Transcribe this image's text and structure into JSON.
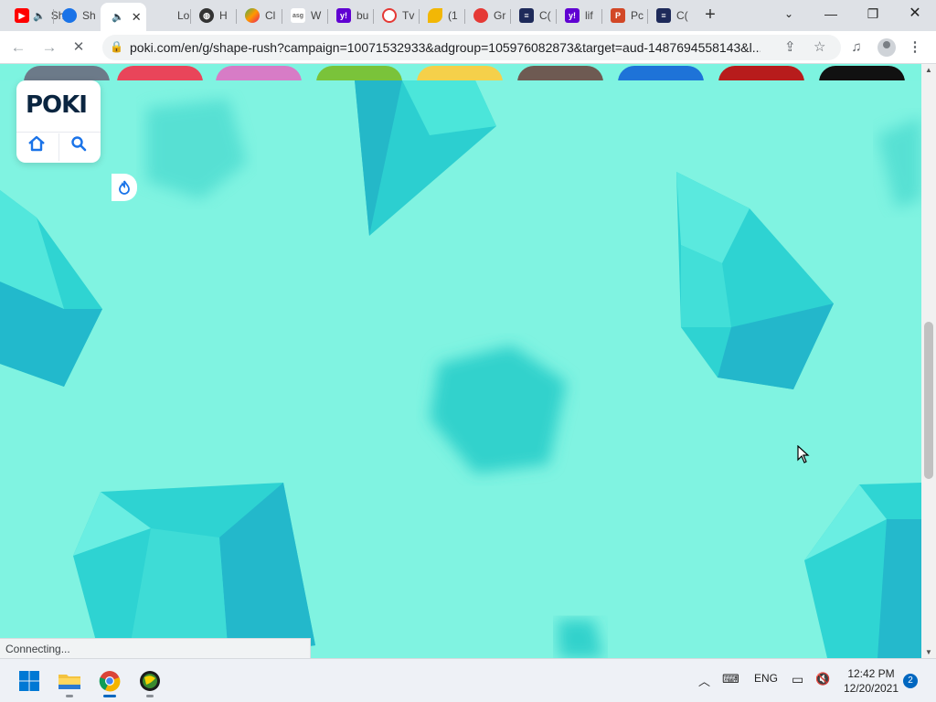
{
  "browser": {
    "tabs": [
      {
        "label": "Sh",
        "icon": "youtube-icon",
        "color": "#ff0000"
      },
      {
        "label": "Sh",
        "icon": "poki-icon",
        "color": "#1a73e8"
      },
      {
        "label": "",
        "icon": "speaker-icon",
        "color": "#333333",
        "active": true
      },
      {
        "label": "Lo",
        "icon": "blank-icon",
        "color": "#cccccc"
      },
      {
        "label": "H",
        "icon": "globe-icon",
        "color": "#333333"
      },
      {
        "label": "Cl",
        "icon": "rainbow-icon",
        "color": "#ff9800"
      },
      {
        "label": "W",
        "icon": "asg-icon",
        "color": "#666666"
      },
      {
        "label": "bu",
        "icon": "yahoo-icon",
        "color": "#6001d2"
      },
      {
        "label": "Tv",
        "icon": "target-icon",
        "color": "#e53935"
      },
      {
        "label": "(1",
        "icon": "leaf-icon",
        "color": "#f2b705"
      },
      {
        "label": "Gr",
        "icon": "brain-icon",
        "color": "#e53935"
      },
      {
        "label": "C(",
        "icon": "docs-icon",
        "color": "#1e2a5a"
      },
      {
        "label": "lif",
        "icon": "yahoo-icon",
        "color": "#6001d2"
      },
      {
        "label": "Pc",
        "icon": "powerpoint-icon",
        "color": "#d24726"
      },
      {
        "label": "C(",
        "icon": "docs-icon",
        "color": "#1e2a5a"
      }
    ],
    "address": "poki.com/en/g/shape-rush?campaign=10071532933&adgroup=105976082873&target=aud-1487694558143&l...",
    "status_text": "Connecting..."
  },
  "page": {
    "logo_text": "POKI",
    "thumb_colors": [
      "#6c7a89",
      "#e9455a",
      "#d77cc6",
      "#7ac33a",
      "#f5d04a",
      "#6e5a52",
      "#1e73d8",
      "#b71c1c",
      "#111111"
    ]
  },
  "taskbar": {
    "lang": "ENG",
    "time": "12:42 PM",
    "date": "12/20/2021",
    "notifications": "2"
  }
}
